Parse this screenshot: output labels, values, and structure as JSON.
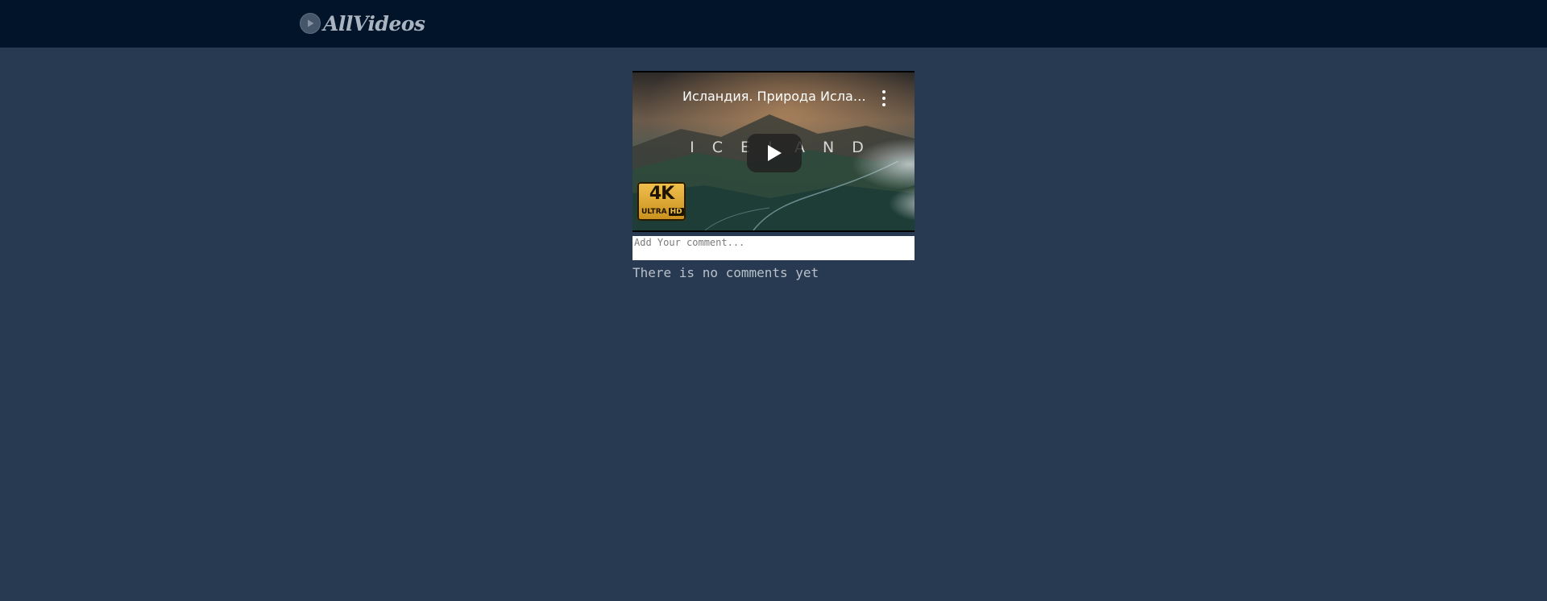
{
  "header": {
    "logo_text": "AllVideos",
    "logo_icon": "play-circle-icon"
  },
  "video": {
    "title": "Исландия. Природа Исландии",
    "overlay_text": "ICELAND",
    "menu_icon": "kebab-menu-icon",
    "play_icon": "play-icon",
    "badge_top": "4K",
    "badge_ultra": "ULTRA",
    "badge_hd": "HD"
  },
  "comments": {
    "placeholder": "Add Your comment...",
    "empty_text": "There is no comments yet"
  },
  "colors": {
    "page_background": "#283a52",
    "header_background": "#021429",
    "logo_text": "#aab4c0",
    "empty_text": "#b8c0c9"
  }
}
